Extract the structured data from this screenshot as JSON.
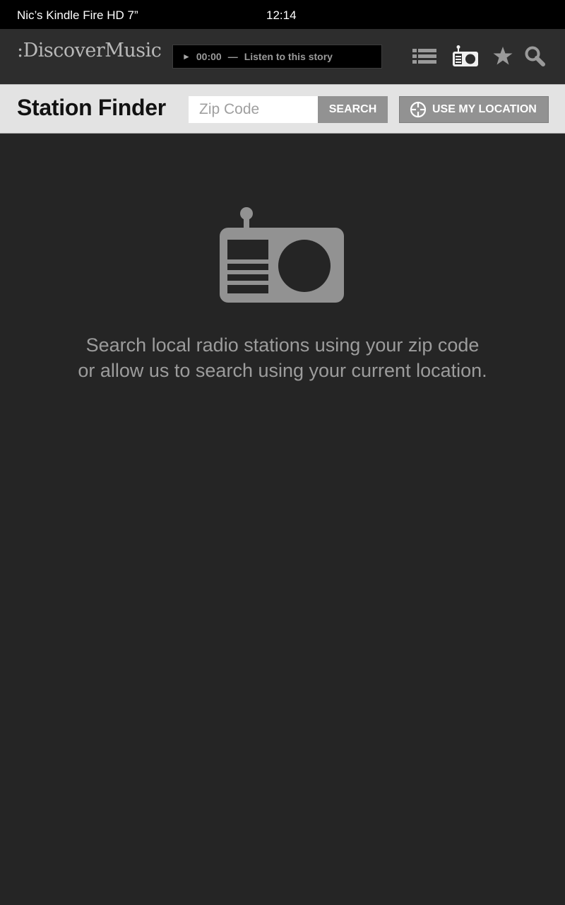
{
  "status_bar": {
    "device_name": "Nic’s Kindle Fire HD 7”",
    "time": "12:14"
  },
  "header": {
    "logo_text": ":DiscoverMusic",
    "player": {
      "play_symbol": "►",
      "time": "00:00",
      "separator": "—",
      "label": "Listen to this story"
    },
    "icons": [
      "list-icon",
      "radio-icon",
      "star-icon",
      "search-icon"
    ]
  },
  "station_finder": {
    "title": "Station Finder",
    "zip_placeholder": "Zip Code",
    "search_label": "SEARCH",
    "location_label": "USE MY LOCATION"
  },
  "empty_state": {
    "icon": "radio-icon",
    "line1": "Search local radio stations using your zip code",
    "line2": "or allow us to search using your current location."
  },
  "colors": {
    "background": "#252525",
    "header": "#2d2d2d",
    "toolbar": "#e3e3e3",
    "button": "#929292",
    "muted_text": "#9c9c9c"
  }
}
